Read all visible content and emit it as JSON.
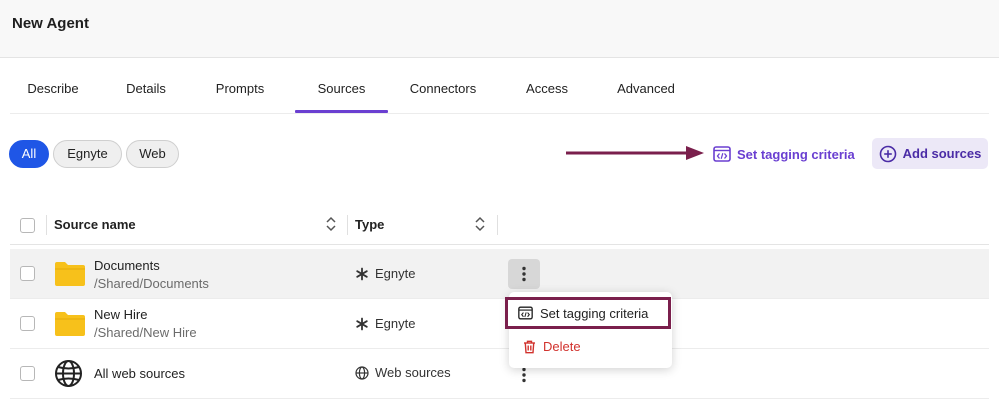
{
  "header": {
    "title": "New Agent"
  },
  "tabs": [
    {
      "label": "Describe"
    },
    {
      "label": "Details"
    },
    {
      "label": "Prompts"
    },
    {
      "label": "Sources",
      "active": true
    },
    {
      "label": "Connectors"
    },
    {
      "label": "Access"
    },
    {
      "label": "Advanced"
    }
  ],
  "filters": [
    {
      "label": "All",
      "active": true
    },
    {
      "label": "Egnyte"
    },
    {
      "label": "Web"
    }
  ],
  "actions": {
    "tagging_label": "Set tagging criteria",
    "add_sources_label": "Add sources"
  },
  "table": {
    "columns": {
      "name": "Source name",
      "type": "Type"
    },
    "rows": [
      {
        "name": "Documents",
        "path": "/Shared/Documents",
        "type": "Egnyte",
        "icon": "folder-icon",
        "type_icon": "egnyte-icon"
      },
      {
        "name": "New Hire",
        "path": "/Shared/New Hire",
        "type": "Egnyte",
        "icon": "folder-icon",
        "type_icon": "egnyte-icon"
      },
      {
        "name": "All web sources",
        "path": "",
        "type": "Web sources",
        "icon": "globe-icon",
        "type_icon": "globe-icon"
      }
    ]
  },
  "row_menu": {
    "set_tagging_label": "Set tagging criteria",
    "delete_label": "Delete"
  },
  "colors": {
    "accent_purple": "#6a3fd1",
    "chip_active_blue": "#1f56e6",
    "annotation_maroon": "#7a1f4c",
    "folder_yellow": "#f7c11b",
    "delete_red": "#d1322d"
  }
}
